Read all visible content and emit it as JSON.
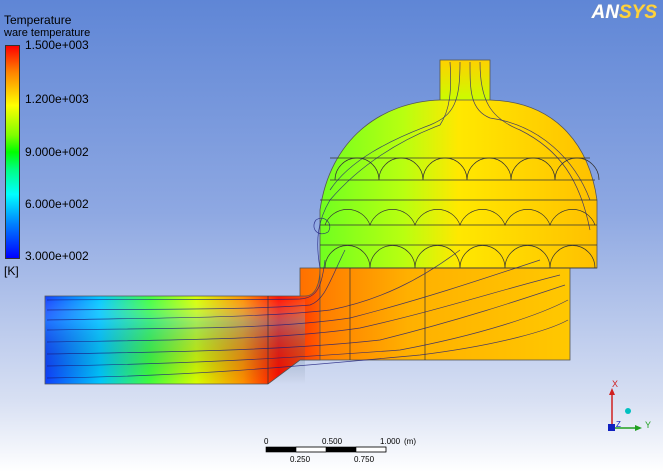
{
  "legend": {
    "title": "Temperature",
    "variable": "ware temperature",
    "ticks": [
      "1.500e+003",
      "1.200e+003",
      "9.000e+002",
      "6.000e+002",
      "3.000e+002"
    ],
    "unit": "[K]"
  },
  "logo": {
    "part1": "AN",
    "part2": "SYS"
  },
  "scale": {
    "top_labels": [
      "0",
      "0.500",
      "1.000",
      "(m)"
    ],
    "bottom_labels": [
      "0.250",
      "0.750"
    ]
  },
  "axes": {
    "x": "X",
    "y": "Y",
    "z": "Z"
  },
  "colors": {
    "hot": "#ff1a00",
    "warm": "#ffa000",
    "mid": "#40ff00",
    "cool": "#00e0ff",
    "cold": "#0030ff"
  }
}
